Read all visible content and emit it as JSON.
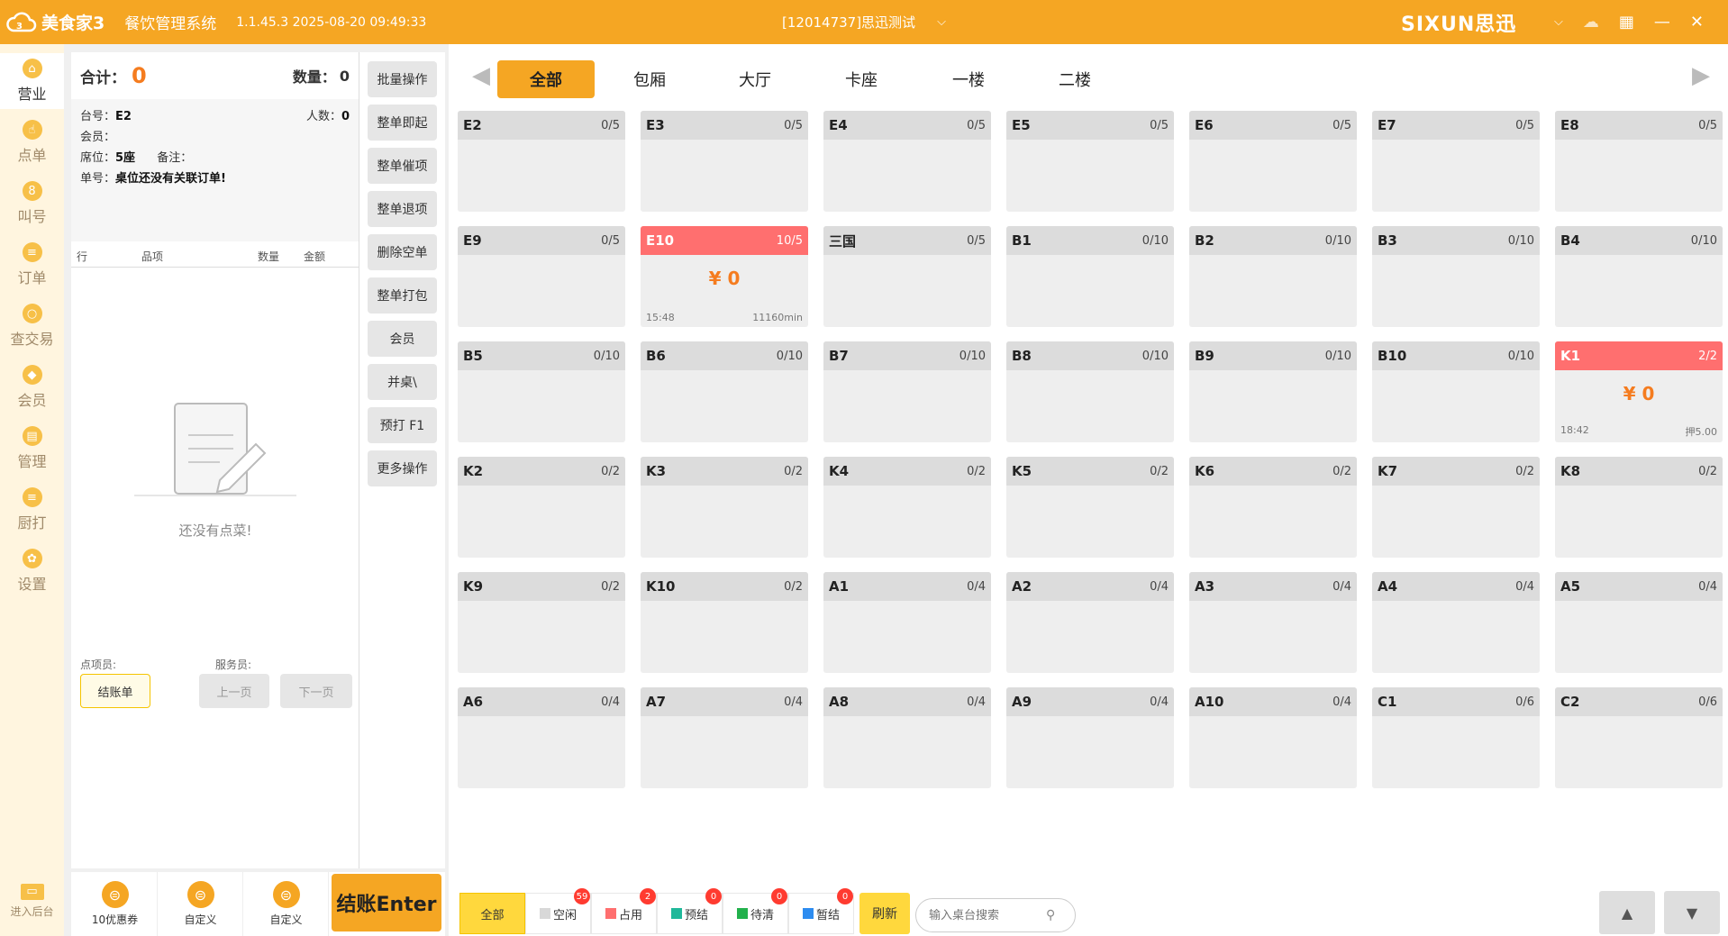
{
  "titlebar": {
    "app_name": "美食家3",
    "system_name": "餐饮管理系统",
    "version": "1.1.45.3 2025-08-20 09:49:33",
    "store": "[12014737]思迅测试",
    "brand": "SIXUN思迅"
  },
  "sidenav": {
    "items": [
      {
        "label": "营业",
        "active": true
      },
      {
        "label": "点单"
      },
      {
        "label": "叫号"
      },
      {
        "label": "订单"
      },
      {
        "label": "查交易"
      },
      {
        "label": "会员"
      },
      {
        "label": "管理"
      },
      {
        "label": "厨打"
      },
      {
        "label": "设置"
      }
    ],
    "backend_label": "进入后台"
  },
  "order": {
    "total_label": "合计：",
    "total_value": "0",
    "qty_label": "数量：",
    "qty_value": "0",
    "table_label": "台号：",
    "table_value": "E2",
    "people_label": "人数：",
    "people_value": "0",
    "member_label": "会员：",
    "seat_label": "席位：",
    "seat_value": "5座",
    "remark_label": "备注：",
    "order_no_label": "单号：",
    "order_no_value": "桌位还没有关联订单!",
    "columns": [
      "行",
      "品项",
      "数量",
      "金额"
    ],
    "empty_text": "还没有点菜!",
    "orderer_label": "点项员:",
    "waiter_label": "服务员:",
    "bill_btn": "结账单",
    "prev_page": "上一页",
    "next_page": "下一页"
  },
  "operations": [
    "批量操作",
    "整单即起",
    "整单催项",
    "整单退项",
    "删除空单",
    "整单打包",
    "会员",
    "并桌\\",
    "预打 F1",
    "更多操作"
  ],
  "bottom_left": {
    "items": [
      "10优惠券",
      "自定义",
      "自定义"
    ],
    "checkout": "结账Enter"
  },
  "tabs": [
    {
      "label": "全部",
      "active": true
    },
    {
      "label": "包厢"
    },
    {
      "label": "大厅"
    },
    {
      "label": "卡座"
    },
    {
      "label": "一楼"
    },
    {
      "label": "二楼"
    }
  ],
  "tables": [
    {
      "name": "E2",
      "cap": "0/5"
    },
    {
      "name": "E3",
      "cap": "0/5"
    },
    {
      "name": "E4",
      "cap": "0/5"
    },
    {
      "name": "E5",
      "cap": "0/5"
    },
    {
      "name": "E6",
      "cap": "0/5"
    },
    {
      "name": "E7",
      "cap": "0/5"
    },
    {
      "name": "E8",
      "cap": "0/5"
    },
    {
      "name": "E9",
      "cap": "0/5"
    },
    {
      "name": "E10",
      "cap": "10/5",
      "busy": true,
      "amount": "¥ 0",
      "time": "15:48",
      "extra": "11160min"
    },
    {
      "name": "三国",
      "cap": "0/5"
    },
    {
      "name": "B1",
      "cap": "0/10"
    },
    {
      "name": "B2",
      "cap": "0/10"
    },
    {
      "name": "B3",
      "cap": "0/10"
    },
    {
      "name": "B4",
      "cap": "0/10"
    },
    {
      "name": "B5",
      "cap": "0/10"
    },
    {
      "name": "B6",
      "cap": "0/10"
    },
    {
      "name": "B7",
      "cap": "0/10"
    },
    {
      "name": "B8",
      "cap": "0/10"
    },
    {
      "name": "B9",
      "cap": "0/10"
    },
    {
      "name": "B10",
      "cap": "0/10"
    },
    {
      "name": "K1",
      "cap": "2/2",
      "busy": true,
      "amount": "¥ 0",
      "time": "18:42",
      "extra": "押5.00"
    },
    {
      "name": "K2",
      "cap": "0/2"
    },
    {
      "name": "K3",
      "cap": "0/2"
    },
    {
      "name": "K4",
      "cap": "0/2"
    },
    {
      "name": "K5",
      "cap": "0/2"
    },
    {
      "name": "K6",
      "cap": "0/2"
    },
    {
      "name": "K7",
      "cap": "0/2"
    },
    {
      "name": "K8",
      "cap": "0/2"
    },
    {
      "name": "K9",
      "cap": "0/2"
    },
    {
      "name": "K10",
      "cap": "0/2"
    },
    {
      "name": "A1",
      "cap": "0/4"
    },
    {
      "name": "A2",
      "cap": "0/4"
    },
    {
      "name": "A3",
      "cap": "0/4"
    },
    {
      "name": "A4",
      "cap": "0/4"
    },
    {
      "name": "A5",
      "cap": "0/4"
    },
    {
      "name": "A6",
      "cap": "0/4"
    },
    {
      "name": "A7",
      "cap": "0/4"
    },
    {
      "name": "A8",
      "cap": "0/4"
    },
    {
      "name": "A9",
      "cap": "0/4"
    },
    {
      "name": "A10",
      "cap": "0/4"
    },
    {
      "name": "C1",
      "cap": "0/6"
    },
    {
      "name": "C2",
      "cap": "0/6"
    }
  ],
  "status_filters": [
    {
      "label": "全部",
      "active": true
    },
    {
      "label": "空闲",
      "badge": "59",
      "color": "#d8d8d8"
    },
    {
      "label": "占用",
      "badge": "2",
      "color": "#ff6f6f"
    },
    {
      "label": "预结",
      "badge": "0",
      "color": "#1fb89a"
    },
    {
      "label": "待清",
      "badge": "0",
      "color": "#22b14c"
    },
    {
      "label": "暂结",
      "badge": "0",
      "color": "#2d8cf0"
    }
  ],
  "refresh_label": "刷新",
  "search_placeholder": "输入桌台搜索",
  "colors": {
    "accent": "#f5a623",
    "busy": "#ff6f6f",
    "amount": "#f57c1f"
  }
}
